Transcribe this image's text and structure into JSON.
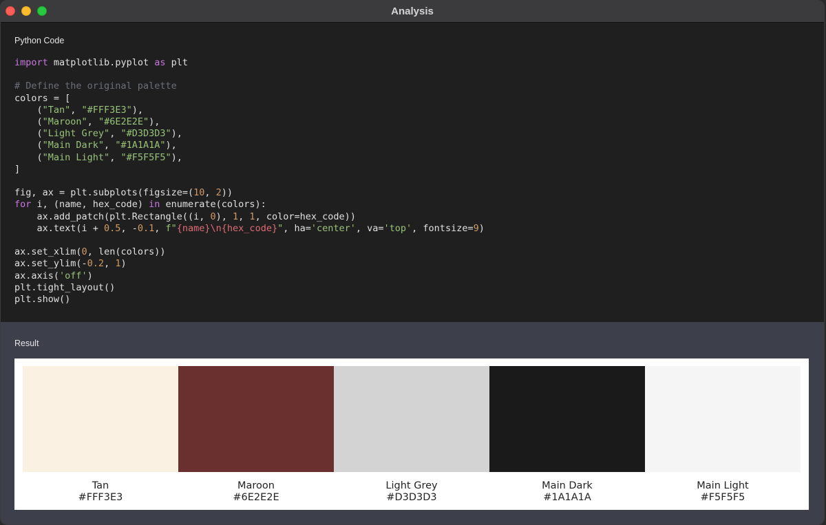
{
  "window": {
    "title": "Analysis"
  },
  "code_section": {
    "label": "Python Code",
    "lines": [
      "import matplotlib.pyplot as plt",
      "",
      "# Define the original palette",
      "colors = [",
      "    (\"Tan\", \"#FFF3E3\"),",
      "    (\"Maroon\", \"#6E2E2E\"),",
      "    (\"Light Grey\", \"#D3D3D3\"),",
      "    (\"Main Dark\", \"#1A1A1A\"),",
      "    (\"Main Light\", \"#F5F5F5\"),",
      "]",
      "",
      "fig, ax = plt.subplots(figsize=(10, 2))",
      "for i, (name, hex_code) in enumerate(colors):",
      "    ax.add_patch(plt.Rectangle((i, 0), 1, 1, color=hex_code))",
      "    ax.text(i + 0.5, -0.1, f\"{name}\\n{hex_code}\", ha='center', va='top', fontsize=9)",
      "",
      "ax.set_xlim(0, len(colors))",
      "ax.set_ylim(-0.2, 1)",
      "ax.axis('off')",
      "plt.tight_layout()",
      "plt.show()"
    ]
  },
  "result_section": {
    "label": "Result",
    "swatches": [
      {
        "name": "Tan",
        "hex": "#FFF3E3",
        "display_color": "#FBF1E2"
      },
      {
        "name": "Maroon",
        "hex": "#6E2E2E",
        "display_color": "#6A3030"
      },
      {
        "name": "Light Grey",
        "hex": "#D3D3D3",
        "display_color": "#D3D3D3"
      },
      {
        "name": "Main Dark",
        "hex": "#1A1A1A",
        "display_color": "#1A1A1A"
      },
      {
        "name": "Main Light",
        "hex": "#F5F5F5",
        "display_color": "#F5F5F5"
      }
    ]
  }
}
